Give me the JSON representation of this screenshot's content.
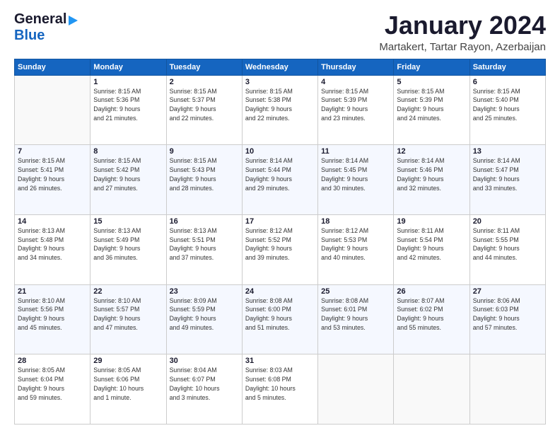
{
  "logo": {
    "line1": "General",
    "line2": "Blue"
  },
  "title": "January 2024",
  "subtitle": "Martakert, Tartar Rayon, Azerbaijan",
  "days": [
    "Sunday",
    "Monday",
    "Tuesday",
    "Wednesday",
    "Thursday",
    "Friday",
    "Saturday"
  ],
  "weeks": [
    [
      {
        "num": "",
        "sunrise": "",
        "sunset": "",
        "daylight": "",
        "empty": true
      },
      {
        "num": "1",
        "sunrise": "Sunrise: 8:15 AM",
        "sunset": "Sunset: 5:36 PM",
        "daylight": "Daylight: 9 hours and 21 minutes."
      },
      {
        "num": "2",
        "sunrise": "Sunrise: 8:15 AM",
        "sunset": "Sunset: 5:37 PM",
        "daylight": "Daylight: 9 hours and 22 minutes."
      },
      {
        "num": "3",
        "sunrise": "Sunrise: 8:15 AM",
        "sunset": "Sunset: 5:38 PM",
        "daylight": "Daylight: 9 hours and 22 minutes."
      },
      {
        "num": "4",
        "sunrise": "Sunrise: 8:15 AM",
        "sunset": "Sunset: 5:39 PM",
        "daylight": "Daylight: 9 hours and 23 minutes."
      },
      {
        "num": "5",
        "sunrise": "Sunrise: 8:15 AM",
        "sunset": "Sunset: 5:39 PM",
        "daylight": "Daylight: 9 hours and 24 minutes."
      },
      {
        "num": "6",
        "sunrise": "Sunrise: 8:15 AM",
        "sunset": "Sunset: 5:40 PM",
        "daylight": "Daylight: 9 hours and 25 minutes."
      }
    ],
    [
      {
        "num": "7",
        "sunrise": "Sunrise: 8:15 AM",
        "sunset": "Sunset: 5:41 PM",
        "daylight": "Daylight: 9 hours and 26 minutes."
      },
      {
        "num": "8",
        "sunrise": "Sunrise: 8:15 AM",
        "sunset": "Sunset: 5:42 PM",
        "daylight": "Daylight: 9 hours and 27 minutes."
      },
      {
        "num": "9",
        "sunrise": "Sunrise: 8:15 AM",
        "sunset": "Sunset: 5:43 PM",
        "daylight": "Daylight: 9 hours and 28 minutes."
      },
      {
        "num": "10",
        "sunrise": "Sunrise: 8:14 AM",
        "sunset": "Sunset: 5:44 PM",
        "daylight": "Daylight: 9 hours and 29 minutes."
      },
      {
        "num": "11",
        "sunrise": "Sunrise: 8:14 AM",
        "sunset": "Sunset: 5:45 PM",
        "daylight": "Daylight: 9 hours and 30 minutes."
      },
      {
        "num": "12",
        "sunrise": "Sunrise: 8:14 AM",
        "sunset": "Sunset: 5:46 PM",
        "daylight": "Daylight: 9 hours and 32 minutes."
      },
      {
        "num": "13",
        "sunrise": "Sunrise: 8:14 AM",
        "sunset": "Sunset: 5:47 PM",
        "daylight": "Daylight: 9 hours and 33 minutes."
      }
    ],
    [
      {
        "num": "14",
        "sunrise": "Sunrise: 8:13 AM",
        "sunset": "Sunset: 5:48 PM",
        "daylight": "Daylight: 9 hours and 34 minutes."
      },
      {
        "num": "15",
        "sunrise": "Sunrise: 8:13 AM",
        "sunset": "Sunset: 5:49 PM",
        "daylight": "Daylight: 9 hours and 36 minutes."
      },
      {
        "num": "16",
        "sunrise": "Sunrise: 8:13 AM",
        "sunset": "Sunset: 5:51 PM",
        "daylight": "Daylight: 9 hours and 37 minutes."
      },
      {
        "num": "17",
        "sunrise": "Sunrise: 8:12 AM",
        "sunset": "Sunset: 5:52 PM",
        "daylight": "Daylight: 9 hours and 39 minutes."
      },
      {
        "num": "18",
        "sunrise": "Sunrise: 8:12 AM",
        "sunset": "Sunset: 5:53 PM",
        "daylight": "Daylight: 9 hours and 40 minutes."
      },
      {
        "num": "19",
        "sunrise": "Sunrise: 8:11 AM",
        "sunset": "Sunset: 5:54 PM",
        "daylight": "Daylight: 9 hours and 42 minutes."
      },
      {
        "num": "20",
        "sunrise": "Sunrise: 8:11 AM",
        "sunset": "Sunset: 5:55 PM",
        "daylight": "Daylight: 9 hours and 44 minutes."
      }
    ],
    [
      {
        "num": "21",
        "sunrise": "Sunrise: 8:10 AM",
        "sunset": "Sunset: 5:56 PM",
        "daylight": "Daylight: 9 hours and 45 minutes."
      },
      {
        "num": "22",
        "sunrise": "Sunrise: 8:10 AM",
        "sunset": "Sunset: 5:57 PM",
        "daylight": "Daylight: 9 hours and 47 minutes."
      },
      {
        "num": "23",
        "sunrise": "Sunrise: 8:09 AM",
        "sunset": "Sunset: 5:59 PM",
        "daylight": "Daylight: 9 hours and 49 minutes."
      },
      {
        "num": "24",
        "sunrise": "Sunrise: 8:08 AM",
        "sunset": "Sunset: 6:00 PM",
        "daylight": "Daylight: 9 hours and 51 minutes."
      },
      {
        "num": "25",
        "sunrise": "Sunrise: 8:08 AM",
        "sunset": "Sunset: 6:01 PM",
        "daylight": "Daylight: 9 hours and 53 minutes."
      },
      {
        "num": "26",
        "sunrise": "Sunrise: 8:07 AM",
        "sunset": "Sunset: 6:02 PM",
        "daylight": "Daylight: 9 hours and 55 minutes."
      },
      {
        "num": "27",
        "sunrise": "Sunrise: 8:06 AM",
        "sunset": "Sunset: 6:03 PM",
        "daylight": "Daylight: 9 hours and 57 minutes."
      }
    ],
    [
      {
        "num": "28",
        "sunrise": "Sunrise: 8:05 AM",
        "sunset": "Sunset: 6:04 PM",
        "daylight": "Daylight: 9 hours and 59 minutes."
      },
      {
        "num": "29",
        "sunrise": "Sunrise: 8:05 AM",
        "sunset": "Sunset: 6:06 PM",
        "daylight": "Daylight: 10 hours and 1 minute."
      },
      {
        "num": "30",
        "sunrise": "Sunrise: 8:04 AM",
        "sunset": "Sunset: 6:07 PM",
        "daylight": "Daylight: 10 hours and 3 minutes."
      },
      {
        "num": "31",
        "sunrise": "Sunrise: 8:03 AM",
        "sunset": "Sunset: 6:08 PM",
        "daylight": "Daylight: 10 hours and 5 minutes."
      },
      {
        "num": "",
        "sunrise": "",
        "sunset": "",
        "daylight": "",
        "empty": true
      },
      {
        "num": "",
        "sunrise": "",
        "sunset": "",
        "daylight": "",
        "empty": true
      },
      {
        "num": "",
        "sunrise": "",
        "sunset": "",
        "daylight": "",
        "empty": true
      }
    ]
  ]
}
